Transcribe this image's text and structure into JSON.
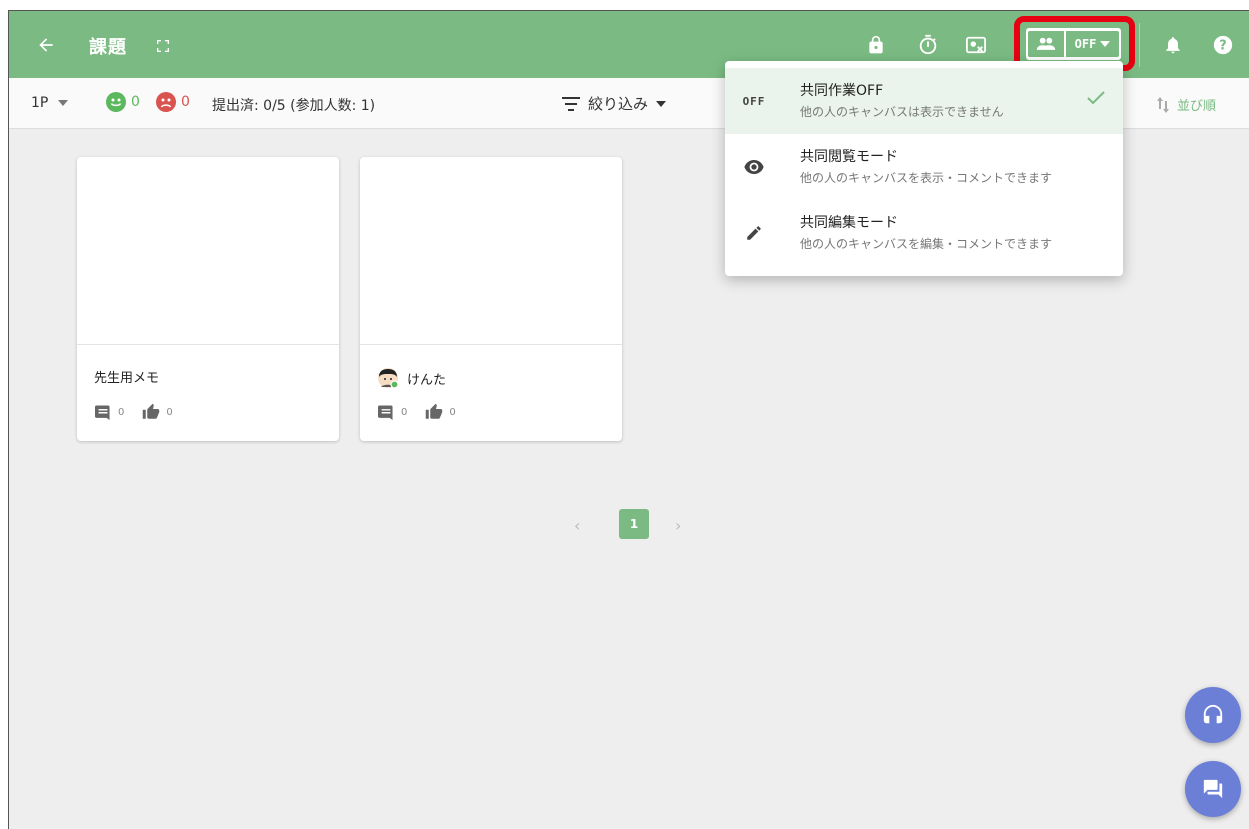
{
  "header": {
    "title": "課題",
    "collab_toggle_label": "OFF"
  },
  "subbar": {
    "page_label": "1P",
    "smile_count": "0",
    "frown_count": "0",
    "submitted_text": "提出済: 0/5 (参加人数: 1)",
    "filter_label": "絞り込み",
    "sort_label": "並び順"
  },
  "cards": [
    {
      "name": "先生用メモ",
      "comments": "0",
      "likes": "0",
      "has_avatar": false
    },
    {
      "name": "けんた",
      "comments": "0",
      "likes": "0",
      "has_avatar": true
    }
  ],
  "pagination": {
    "prev": "‹",
    "current": "1",
    "next": "›"
  },
  "menu": {
    "items": [
      {
        "icon_text": "OFF",
        "title": "共同作業OFF",
        "subtitle": "他の人のキャンバスは表示できません",
        "selected": true
      },
      {
        "icon": "eye-icon",
        "title": "共同閲覧モード",
        "subtitle": "他の人のキャンバスを表示・コメントできます",
        "selected": false
      },
      {
        "icon": "pencil-icon",
        "title": "共同編集モード",
        "subtitle": "他の人のキャンバスを編集・コメントできます",
        "selected": false
      }
    ]
  },
  "colors": {
    "primary": "#7bbb83",
    "highlight": "#e60012",
    "fab": "#6b7fd7",
    "smile": "#5cb85c",
    "frown": "#d9534f"
  }
}
